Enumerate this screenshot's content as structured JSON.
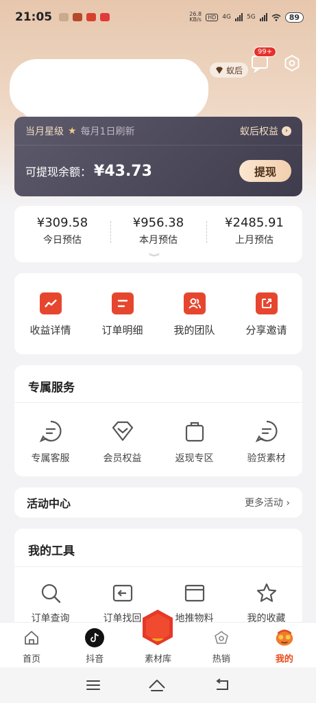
{
  "status_bar": {
    "time": "21:05",
    "net_speed_value": "26.8",
    "net_speed_unit": "KB/s",
    "hd_tag": "HD",
    "net_4g": "4G",
    "net_5g": "5G",
    "battery": "89"
  },
  "header": {
    "vip_label": "蚁后",
    "message_badge": "99+"
  },
  "rank_card": {
    "level_label": "当月星级",
    "refresh_text": "每月1日刷新",
    "rights_label": "蚁后权益",
    "balance_label": "可提现余额：",
    "balance_value": "¥43.73",
    "withdraw_label": "提现"
  },
  "estimates": [
    {
      "value": "¥309.58",
      "label": "今日预估"
    },
    {
      "value": "¥956.38",
      "label": "本月预估"
    },
    {
      "value": "¥2485.91",
      "label": "上月预估"
    }
  ],
  "quick_actions": [
    {
      "label": "收益详情",
      "icon": "trend-chart-icon"
    },
    {
      "label": "订单明细",
      "icon": "order-list-icon"
    },
    {
      "label": "我的团队",
      "icon": "team-icon"
    },
    {
      "label": "分享邀请",
      "icon": "share-icon"
    }
  ],
  "services": {
    "title": "专属服务",
    "items": [
      {
        "label": "专属客服",
        "icon": "chat-bubble-icon"
      },
      {
        "label": "会员权益",
        "icon": "diamond-icon"
      },
      {
        "label": "返现专区",
        "icon": "shopping-bag-icon"
      },
      {
        "label": "验货素材",
        "icon": "chat-bubble-icon"
      }
    ]
  },
  "activity": {
    "title": "活动中心",
    "more": "更多活动"
  },
  "tools": {
    "title": "我的工具",
    "items": [
      {
        "label": "订单查询",
        "icon": "search-icon"
      },
      {
        "label": "订单找回",
        "icon": "return-icon"
      },
      {
        "label": "地推物料",
        "icon": "folder-icon"
      },
      {
        "label": "我的收藏",
        "icon": "star-icon"
      }
    ]
  },
  "bottom_nav": [
    {
      "label": "首页",
      "icon": "home-icon"
    },
    {
      "label": "抖音",
      "icon": "tiktok-icon"
    },
    {
      "label": "素材库",
      "icon": "hexagon-icon"
    },
    {
      "label": "热销",
      "icon": "hot-sale-icon"
    },
    {
      "label": "我的",
      "icon": "profile-avatar-icon",
      "active": true
    }
  ],
  "colors": {
    "accent": "#e6462e",
    "active_nav": "#e94a1a",
    "card_dark": "#4b4859",
    "gold": "#f3dcc2"
  }
}
